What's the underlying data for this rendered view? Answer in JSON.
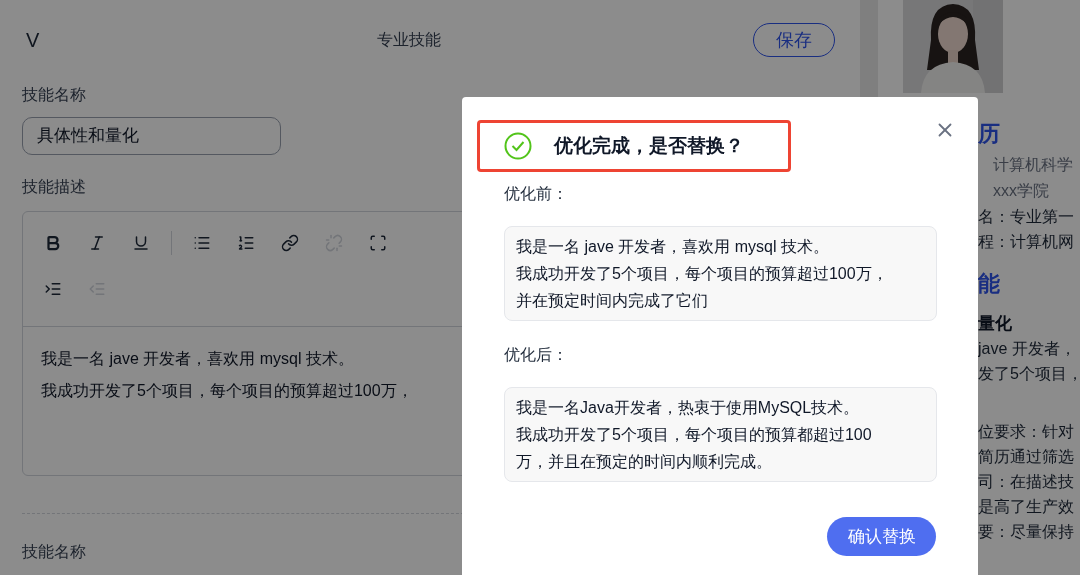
{
  "editor_panel": {
    "collapse_icon": "V",
    "title": "专业技能",
    "save_button": "保存",
    "skills": [
      {
        "name_label": "技能名称",
        "name_value": "具体性和量化",
        "desc_label": "技能描述",
        "toolbar": [
          {
            "kind": "bold",
            "disabled": false
          },
          {
            "kind": "italic",
            "disabled": false
          },
          {
            "kind": "underline",
            "disabled": false
          },
          {
            "kind": "divider"
          },
          {
            "kind": "bullet-list",
            "disabled": false
          },
          {
            "kind": "numbered-list",
            "disabled": false
          },
          {
            "kind": "link",
            "disabled": false
          },
          {
            "kind": "unlink",
            "disabled": true
          },
          {
            "kind": "fullscreen",
            "disabled": false
          },
          {
            "kind": "indent",
            "disabled": false
          },
          {
            "kind": "outdent",
            "disabled": true
          }
        ],
        "content": [
          "我是一名 jave 开发者，喜欢用 mysql 技术。",
          "我成功开发了5个项目，每个项目的预算超过100万，"
        ]
      },
      {
        "name_label": "技能名称"
      }
    ]
  },
  "resume_preview": {
    "lines": [
      {
        "kind": "heading",
        "text": "历"
      },
      {
        "kind": "muted",
        "text": "计算机科学"
      },
      {
        "kind": "muted",
        "text": "xxx学院"
      },
      {
        "kind": "body",
        "text": "名：专业第一"
      },
      {
        "kind": "body",
        "text": "程：计算机网"
      },
      {
        "kind": "heading",
        "text": "能"
      },
      {
        "kind": "subheading",
        "text": "量化"
      },
      {
        "kind": "body",
        "text": "jave 开发者，"
      },
      {
        "kind": "body",
        "text": "发了5个项目，"
      },
      {
        "kind": "gap"
      },
      {
        "kind": "body",
        "text": "位要求：针对"
      },
      {
        "kind": "body",
        "text": "简历通过筛选"
      },
      {
        "kind": "body",
        "text": "司：在描述技"
      },
      {
        "kind": "body",
        "text": "是高了生产效"
      },
      {
        "kind": "body",
        "text": "要：尽量保持"
      }
    ]
  },
  "dialog": {
    "title": "优化完成，是否替换？",
    "highlighted": true,
    "before_label": "优化前：",
    "before_text": [
      "我是一名 jave 开发者，喜欢用 mysql 技术。",
      "我成功开发了5个项目，每个项目的预算超过100万，",
      "并在预定时间内完成了它们"
    ],
    "after_label": "优化后：",
    "after_text": [
      "我是一名Java开发者，热衷于使用MySQL技术。",
      "我成功开发了5个项目，每个项目的预算都超过100",
      "万，并且在预定的时间内顺利完成。"
    ],
    "confirm_button": "确认替换"
  }
}
